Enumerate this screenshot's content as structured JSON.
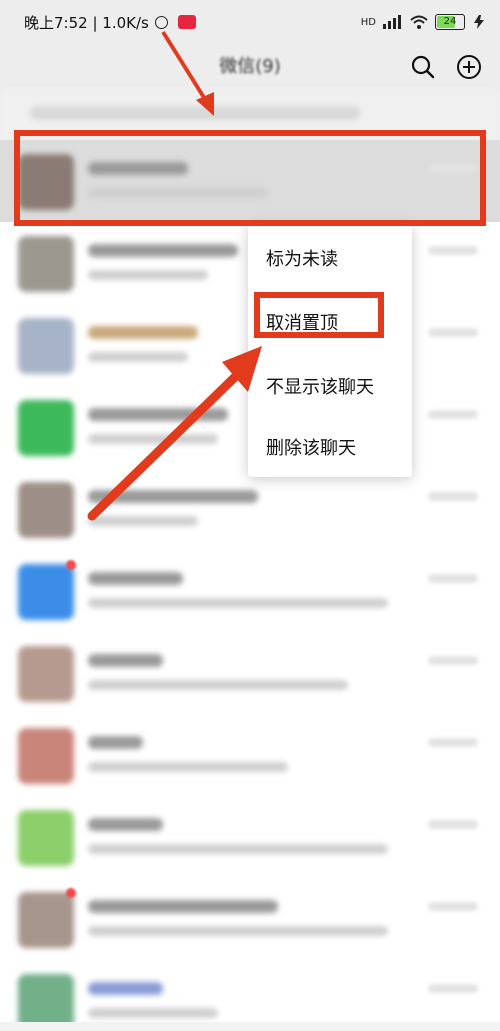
{
  "status_bar": {
    "time_text": "晚上7:52 | 1.0K/s",
    "network_label": "HD",
    "battery_level": "24"
  },
  "header": {
    "title": "微信(9)"
  },
  "context_menu": {
    "items": [
      "标为未读",
      "取消置顶",
      "不显示该聊天",
      "删除该聊天"
    ]
  },
  "colors": {
    "annotation_red": "#e23a1c",
    "background": "#ededed",
    "pinned_row": "#dcdcdc",
    "badge_red": "#e8253e"
  },
  "icons": {
    "search": "search-icon",
    "add": "plus-circle-icon",
    "alarm": "alarm-clock-icon",
    "wifi": "wifi-icon",
    "signal": "signal-icon",
    "battery": "battery-icon"
  }
}
